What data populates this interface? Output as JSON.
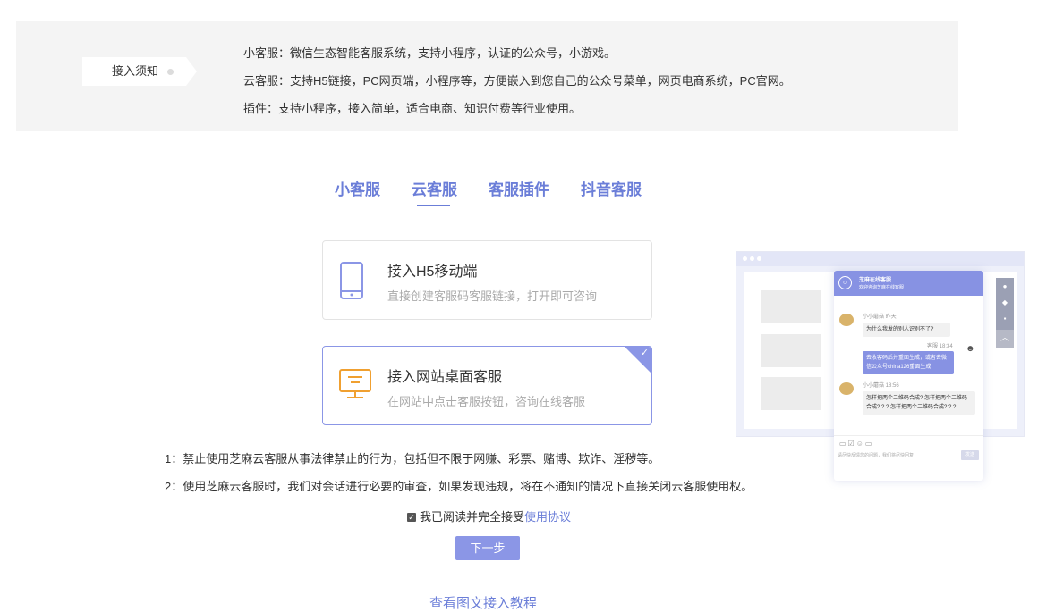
{
  "notice": {
    "tag_label": "接入须知",
    "lines": [
      "小客服：微信生态智能客服系统，支持小程序，认证的公众号，小游戏。",
      "云客服：支持H5链接，PC网页端，小程序等，方便嵌入到您自己的公众号菜单，网页电商系统，PC官网。",
      "插件：支持小程序，接入简单，适合电商、知识付费等行业使用。"
    ]
  },
  "tabs": [
    {
      "label": "小客服",
      "active": false
    },
    {
      "label": "云客服",
      "active": true
    },
    {
      "label": "客服插件",
      "active": false
    },
    {
      "label": "抖音客服",
      "active": false
    }
  ],
  "options": [
    {
      "title": "接入H5移动端",
      "desc": "直接创建客服码客服链接，打开即可咨询",
      "icon": "mobile-phone-icon",
      "selected": false
    },
    {
      "title": "接入网站桌面客服",
      "desc": "在网站中点击客服按钮，咨询在线客服",
      "icon": "desktop-monitor-icon",
      "selected": true
    }
  ],
  "rules": [
    "1：禁止使用芝麻云客服从事法律禁止的行为，包括但不限于网赚、彩票、赌博、欺诈、淫秽等。",
    "2：使用芝麻云客服时，我们对会话进行必要的审查，如果发现违规，将在不通知的情况下直接关闭云客服使用权。"
  ],
  "agreement": {
    "checked": true,
    "text": "我已阅读并完全接受",
    "link": "使用协议"
  },
  "next_button": "下一步",
  "tutorial_link": "查看图文接入教程",
  "preview": {
    "chat_title": "芝麻在线客服",
    "chat_subtitle": "欢迎咨询芝麻在线客服",
    "msg1_meta": "小小蘑菇  昨天",
    "msg1": "为什么我发的别人识别不了?",
    "msg2_meta": "客服  18:34",
    "msg2": "去收客码后并重面生成，或者去微信公众号china126重面生成",
    "msg3_meta": "小小蘑菇  18:56",
    "msg3": "怎样把两个二维码合成? 怎样把两个二维码合成? ? ? 怎样把两个二维码合成? ? ?",
    "input_placeholder": "请尽快反馈您的问题，我们将尽快回复",
    "send_label": "发送"
  },
  "colors": {
    "accent": "#6b7ed8",
    "button": "#8b96e6",
    "notice_bg": "#f4f4f4"
  }
}
